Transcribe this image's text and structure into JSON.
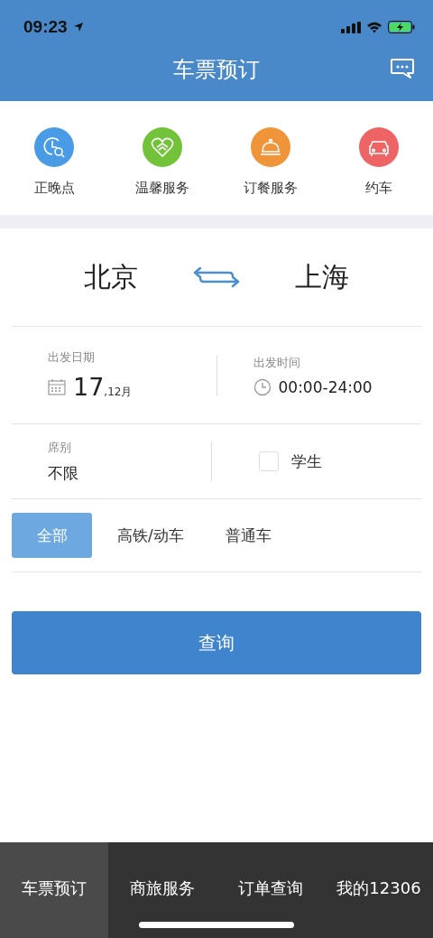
{
  "status_bar": {
    "time": "09:23"
  },
  "header": {
    "title": "车票预订"
  },
  "services": [
    {
      "label": "正晚点",
      "kind": "clock",
      "color": "#4a9be6"
    },
    {
      "label": "温馨服务",
      "kind": "heart",
      "color": "#72c23a"
    },
    {
      "label": "订餐服务",
      "kind": "cloche",
      "color": "#ef9438"
    },
    {
      "label": "约车",
      "kind": "car",
      "color": "#ee6464"
    }
  ],
  "route": {
    "from": "北京",
    "to": "上海"
  },
  "date": {
    "label": "出发日期",
    "day": "17",
    "month": ",12月"
  },
  "time": {
    "label": "出发时间",
    "value": "00:00-24:00"
  },
  "seat": {
    "label": "席别",
    "value": "不限"
  },
  "student": {
    "label": "学生",
    "checked": false
  },
  "train_types": [
    {
      "label": "全部",
      "selected": true
    },
    {
      "label": "高铁/动车",
      "selected": false
    },
    {
      "label": "普通车",
      "selected": false
    }
  ],
  "search_button": "查询",
  "tab_bar": [
    {
      "label": "车票预订",
      "selected": true
    },
    {
      "label": "商旅服务",
      "selected": false
    },
    {
      "label": "订单查询",
      "selected": false
    },
    {
      "label": "我的12306",
      "selected": false
    }
  ]
}
